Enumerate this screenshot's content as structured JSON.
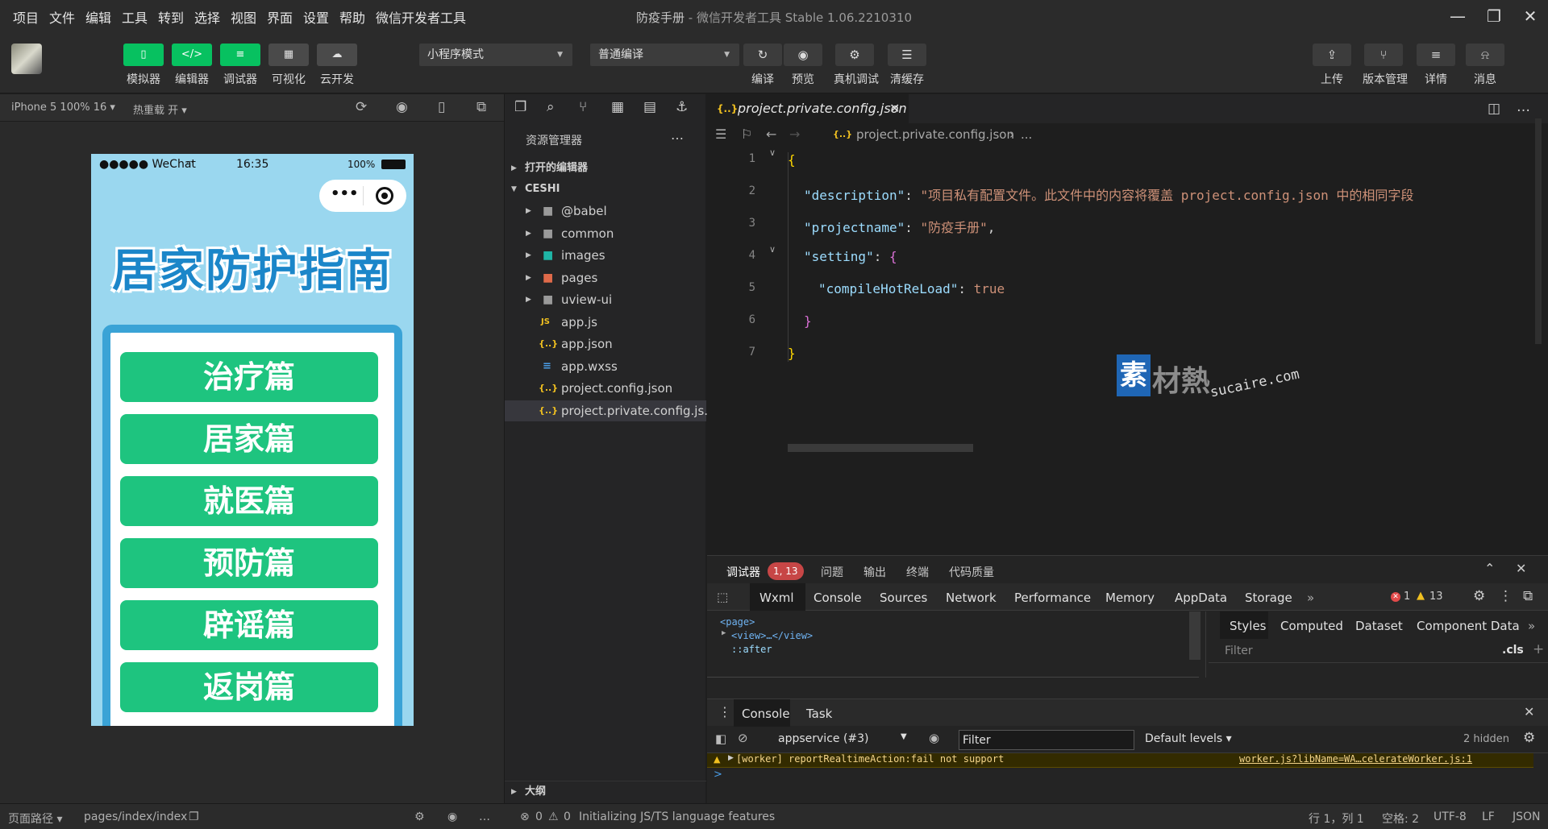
{
  "menu": [
    "项目",
    "文件",
    "编辑",
    "工具",
    "转到",
    "选择",
    "视图",
    "界面",
    "设置",
    "帮助",
    "微信开发者工具"
  ],
  "window": {
    "title": "防疫手册",
    "subtitle": " - 微信开发者工具 Stable 1.06.2210310"
  },
  "toolbar": {
    "buttons": [
      "模拟器",
      "编辑器",
      "调试器",
      "可视化",
      "云开发"
    ],
    "mode_select": "小程序模式",
    "compile_select": "普通编译",
    "actions": [
      "编译",
      "预览",
      "真机调试",
      "清缓存"
    ],
    "right": [
      "上传",
      "版本管理",
      "详情",
      "消息"
    ]
  },
  "simulator": {
    "device": "iPhone 5 100% 16",
    "hot_reload": "热重载 开",
    "status": {
      "carrier": "●●●●● WeChat",
      "time": "16:35",
      "battery": "100%"
    },
    "title": "居家防护指南",
    "buttons": [
      "治疗篇",
      "居家篇",
      "就医篇",
      "预防篇",
      "辟谣篇",
      "返岗篇"
    ]
  },
  "explorer": {
    "header": "资源管理器",
    "open_editors": "打开的编辑器",
    "project": "CESHI",
    "folders": [
      "@babel",
      "common",
      "images",
      "pages",
      "uview-ui"
    ],
    "files": [
      "app.js",
      "app.json",
      "app.wxss",
      "project.config.json",
      "project.private.config.js..."
    ],
    "outline": "大纲"
  },
  "editor": {
    "tab": "project.private.config.json",
    "breadcrumb": "project.private.config.json",
    "breadcrumb_more": "...",
    "line_numbers": [
      "1",
      "2",
      "3",
      "4",
      "5",
      "6",
      "7"
    ],
    "code": {
      "l1": "{",
      "k2": "\"description\"",
      "v2": "\"项目私有配置文件。此文件中的内容将覆盖 project.config.json 中的相同字段",
      "k3": "\"projectname\"",
      "v3": "\"防疫手册\"",
      "k4": "\"setting\"",
      "l4": "{",
      "k5": "\"compileHotReLoad\"",
      "v5": "true",
      "l6": "}",
      "l7": "}"
    },
    "watermark": {
      "mark": "素",
      "cn": "材熱",
      "en": "sucaire.com"
    }
  },
  "debugger": {
    "tabs": [
      "调试器",
      "问题",
      "输出",
      "终端",
      "代码质量"
    ],
    "badge": "1, 13",
    "devtools_tabs": [
      "Wxml",
      "Console",
      "Sources",
      "Network",
      "Performance",
      "Memory",
      "AppData",
      "Storage"
    ],
    "errors": "1",
    "warnings": "13",
    "wxml": [
      "<page>",
      "<view>…</view>",
      "::after"
    ],
    "styles_tabs": [
      "Styles",
      "Computed",
      "Dataset",
      "Component Data"
    ],
    "filter_placeholder": "Filter",
    "cls": ".cls",
    "console_tabs": [
      "Console",
      "Task"
    ],
    "context": "appservice (#3)",
    "console_filter": "Filter",
    "levels": "Default levels",
    "hidden": "2 hidden",
    "log_msg": "[worker] reportRealtimeAction:fail not support",
    "log_src": "worker.js?libName=WA…celerateWorker.js:1",
    "prompt": ">"
  },
  "statusbar": {
    "path_label": "页面路径",
    "path": "pages/index/index",
    "errors": "0",
    "warnings": "0",
    "message": "Initializing JS/TS language features",
    "position": "行 1，列 1",
    "spaces": "空格: 2",
    "encoding": "UTF-8",
    "eol": "LF",
    "lang": "JSON"
  },
  "colors": {
    "accent": "#07c160",
    "phone_bg": "#9ad7ef",
    "phone_btn": "#1ec47f",
    "error_badge": "#c74646"
  }
}
